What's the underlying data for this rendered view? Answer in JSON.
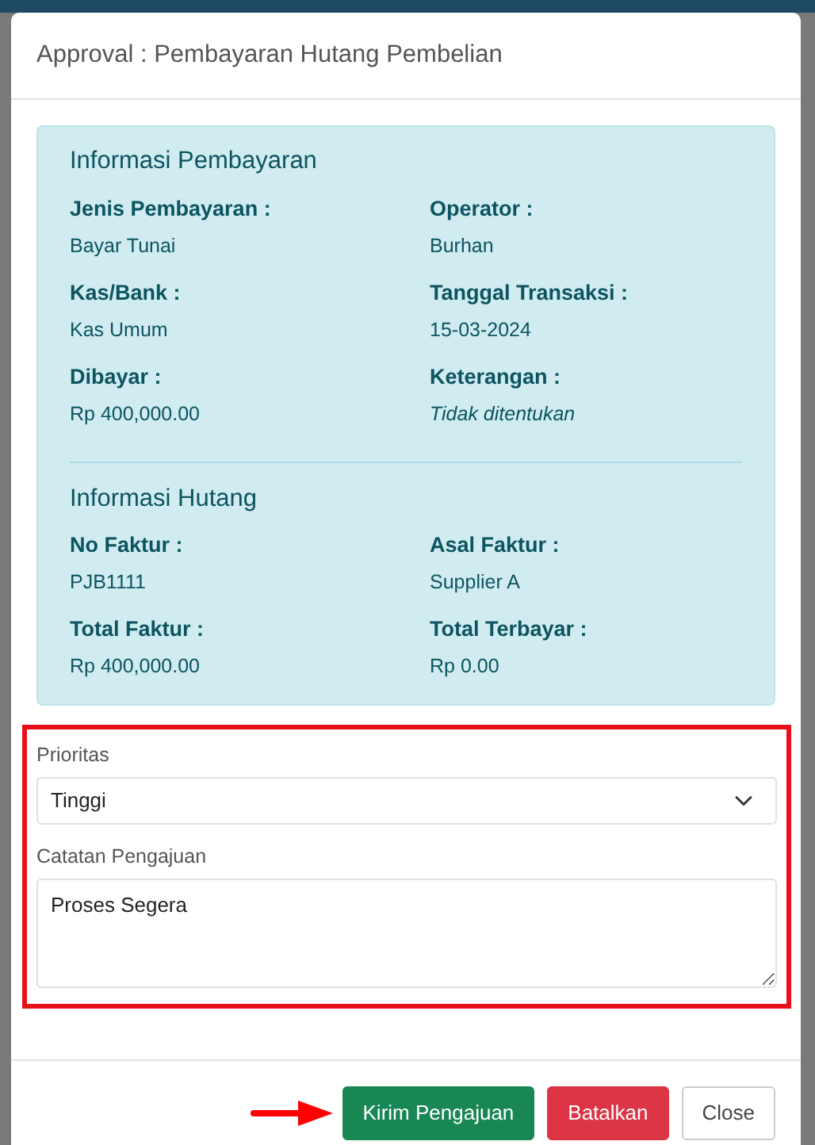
{
  "modal": {
    "title": "Approval : Pembayaran Hutang Pembelian",
    "sections": [
      {
        "heading": "Informasi Pembayaran",
        "fields": [
          {
            "label": "Jenis Pembayaran :",
            "value": "Bayar Tunai",
            "italic": false
          },
          {
            "label": "Operator :",
            "value": "Burhan",
            "italic": false
          },
          {
            "label": "Kas/Bank :",
            "value": "Kas Umum",
            "italic": false
          },
          {
            "label": "Tanggal Transaksi :",
            "value": "15-03-2024",
            "italic": false
          },
          {
            "label": "Dibayar :",
            "value": "Rp 400,000.00",
            "italic": false
          },
          {
            "label": "Keterangan :",
            "value": "Tidak ditentukan",
            "italic": true
          }
        ]
      },
      {
        "heading": "Informasi Hutang",
        "fields": [
          {
            "label": "No Faktur :",
            "value": "PJB1111",
            "italic": false
          },
          {
            "label": "Asal Faktur :",
            "value": "Supplier A",
            "italic": false
          },
          {
            "label": "Total Faktur :",
            "value": "Rp 400,000.00",
            "italic": false
          },
          {
            "label": "Total Terbayar :",
            "value": "Rp 0.00",
            "italic": false
          }
        ]
      }
    ],
    "form": {
      "priority": {
        "label": "Prioritas",
        "value": "Tinggi"
      },
      "notes": {
        "label": "Catatan Pengajuan",
        "value": "Proses Segera"
      }
    },
    "buttons": [
      {
        "label": "Kirim Pengajuan",
        "kind": "success"
      },
      {
        "label": "Batalkan",
        "kind": "danger"
      },
      {
        "label": "Close",
        "kind": "secondary"
      }
    ]
  }
}
